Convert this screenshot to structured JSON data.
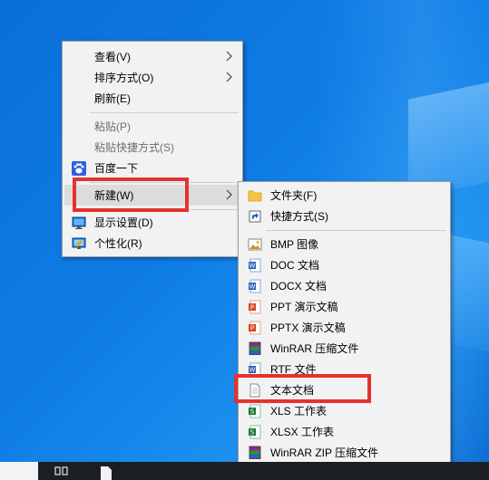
{
  "main_menu": {
    "items": [
      {
        "label": "查看(V)",
        "has_submenu": true,
        "disabled": false
      },
      {
        "label": "排序方式(O)",
        "has_submenu": true,
        "disabled": false
      },
      {
        "label": "刷新(E)",
        "has_submenu": false,
        "disabled": false
      },
      {
        "label": "粘贴(P)",
        "has_submenu": false,
        "disabled": true
      },
      {
        "label": "粘贴快捷方式(S)",
        "has_submenu": false,
        "disabled": true
      },
      {
        "label": "百度一下",
        "has_submenu": false,
        "disabled": false,
        "icon": "paw-icon"
      },
      {
        "label": "新建(W)",
        "has_submenu": true,
        "disabled": false,
        "highlighted": true
      },
      {
        "label": "显示设置(D)",
        "has_submenu": false,
        "disabled": false,
        "icon": "display-icon"
      },
      {
        "label": "个性化(R)",
        "has_submenu": false,
        "disabled": false,
        "icon": "personalize-icon"
      }
    ]
  },
  "new_submenu": {
    "items": [
      {
        "label": "文件夹(F)",
        "icon": "folder-icon"
      },
      {
        "label": "快捷方式(S)",
        "icon": "shortcut-icon"
      },
      {
        "label": "BMP 图像",
        "icon": "bmp-image-icon"
      },
      {
        "label": "DOC 文档",
        "icon": "word-doc-icon"
      },
      {
        "label": "DOCX 文档",
        "icon": "word-docx-icon"
      },
      {
        "label": "PPT 演示文稿",
        "icon": "ppt-icon"
      },
      {
        "label": "PPTX 演示文稿",
        "icon": "pptx-icon"
      },
      {
        "label": "WinRAR 压缩文件",
        "icon": "winrar-icon"
      },
      {
        "label": "RTF 文件",
        "icon": "rtf-icon"
      },
      {
        "label": "文本文档",
        "icon": "text-document-icon",
        "annotated": true
      },
      {
        "label": "XLS 工作表",
        "icon": "xls-icon"
      },
      {
        "label": "XLSX 工作表",
        "icon": "xlsx-icon"
      },
      {
        "label": "WinRAR ZIP 压缩文件",
        "icon": "winrar-zip-icon"
      }
    ]
  },
  "colors": {
    "desktop": "#0f7de6",
    "menu_bg": "#f2f2f2",
    "highlight": "#dcdcdc",
    "annotation": "#e5312f",
    "taskbar": "#1b1f24"
  }
}
